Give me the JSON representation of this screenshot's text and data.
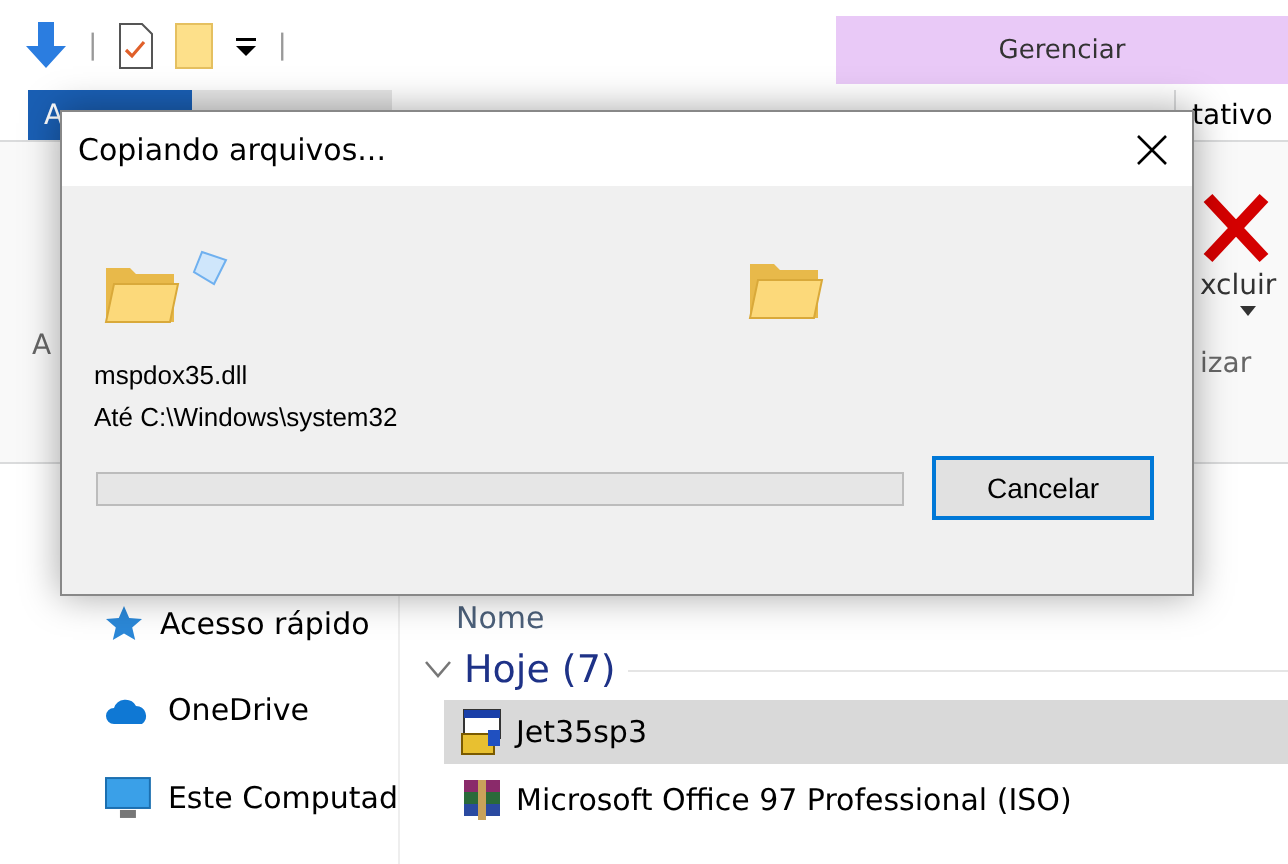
{
  "quick_access_toolbar": {
    "separator_marks": [
      "|",
      "|"
    ]
  },
  "ribbon": {
    "context_tab": "Gerenciar",
    "tabs": [
      {
        "label": "A",
        "selected": true
      },
      {
        "label": "tativo",
        "selected": false
      }
    ],
    "left_label": "A",
    "delete_label": "xcluir",
    "group_label": "izar"
  },
  "navigation": [
    {
      "label": "Acesso rápido",
      "kind": "star"
    },
    {
      "label": "OneDrive",
      "kind": "cloud"
    },
    {
      "label": "Este Computad",
      "kind": "computer"
    }
  ],
  "file_list": {
    "column": "Nome",
    "group": "Hoje (7)",
    "rows": [
      {
        "name": "Jet35sp3",
        "kind": "installer",
        "selected": true
      },
      {
        "name": "Microsoft Office 97 Professional (ISO)",
        "kind": "archive",
        "selected": false
      }
    ]
  },
  "dialog": {
    "title": "Copiando arquivos...",
    "file": "mspdox35.dll",
    "destination": "Até C:\\Windows\\system32",
    "progress": {
      "level": 0
    },
    "button": "Cancelar"
  }
}
